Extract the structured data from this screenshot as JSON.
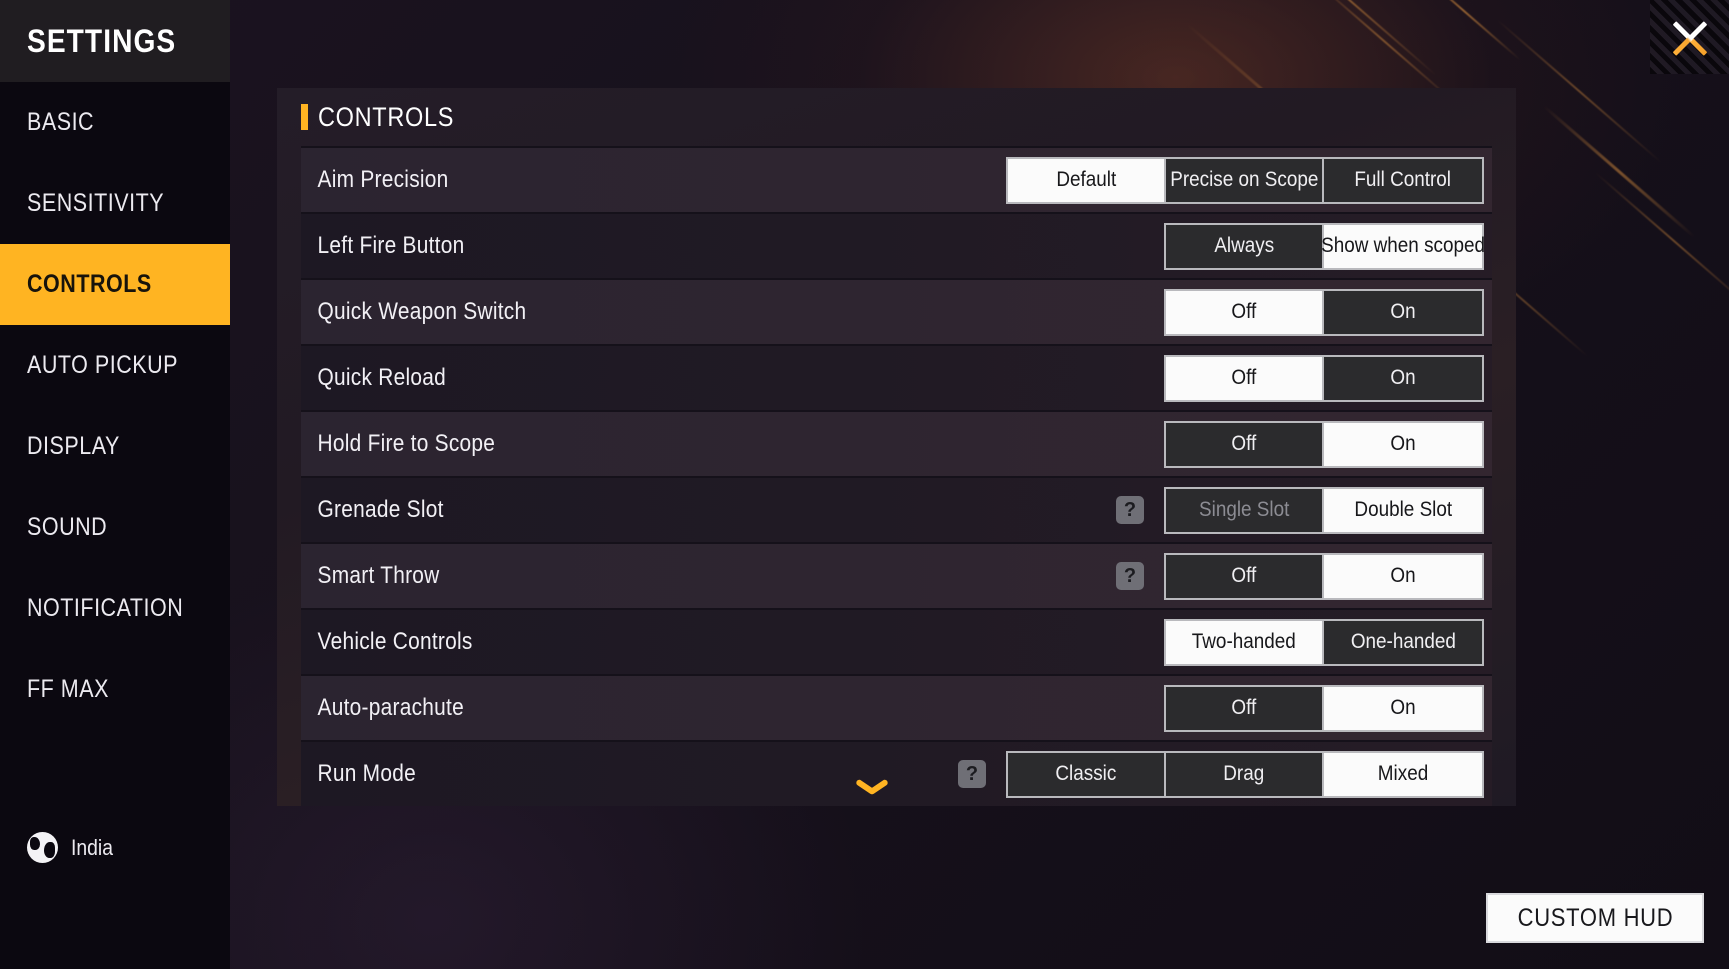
{
  "sidebar": {
    "title": "SETTINGS",
    "items": [
      {
        "label": "BASIC",
        "active": false
      },
      {
        "label": "SENSITIVITY",
        "active": false
      },
      {
        "label": "CONTROLS",
        "active": true
      },
      {
        "label": "AUTO PICKUP",
        "active": false
      },
      {
        "label": "DISPLAY",
        "active": false
      },
      {
        "label": "SOUND",
        "active": false
      },
      {
        "label": "NOTIFICATION",
        "active": false
      },
      {
        "label": "FF MAX",
        "active": false
      }
    ],
    "locale": {
      "icon": "globe-icon",
      "label": "India"
    }
  },
  "panel": {
    "title": "CONTROLS",
    "accent_color": "#FFB422",
    "rows": [
      {
        "label": "Aim Precision",
        "help": false,
        "options": [
          {
            "label": "Default",
            "selected": true,
            "disabled": false
          },
          {
            "label": "Precise on Scope",
            "selected": false,
            "disabled": false
          },
          {
            "label": "Full Control",
            "selected": false,
            "disabled": false
          }
        ]
      },
      {
        "label": "Left Fire Button",
        "help": false,
        "options": [
          {
            "label": "Always",
            "selected": false,
            "disabled": false
          },
          {
            "label": "Show when scoped",
            "selected": true,
            "disabled": false
          }
        ]
      },
      {
        "label": "Quick Weapon Switch",
        "help": false,
        "options": [
          {
            "label": "Off",
            "selected": true,
            "disabled": false
          },
          {
            "label": "On",
            "selected": false,
            "disabled": false
          }
        ]
      },
      {
        "label": "Quick Reload",
        "help": false,
        "options": [
          {
            "label": "Off",
            "selected": true,
            "disabled": false
          },
          {
            "label": "On",
            "selected": false,
            "disabled": false
          }
        ]
      },
      {
        "label": "Hold Fire to Scope",
        "help": false,
        "options": [
          {
            "label": "Off",
            "selected": false,
            "disabled": false
          },
          {
            "label": "On",
            "selected": true,
            "disabled": false
          }
        ]
      },
      {
        "label": "Grenade Slot",
        "help": true,
        "options": [
          {
            "label": "Single Slot",
            "selected": false,
            "disabled": true
          },
          {
            "label": "Double Slot",
            "selected": true,
            "disabled": false
          }
        ]
      },
      {
        "label": "Smart Throw",
        "help": true,
        "options": [
          {
            "label": "Off",
            "selected": false,
            "disabled": false
          },
          {
            "label": "On",
            "selected": true,
            "disabled": false
          }
        ]
      },
      {
        "label": "Vehicle Controls",
        "help": false,
        "options": [
          {
            "label": "Two-handed",
            "selected": true,
            "disabled": false
          },
          {
            "label": "One-handed",
            "selected": false,
            "disabled": false
          }
        ]
      },
      {
        "label": "Auto-parachute",
        "help": false,
        "options": [
          {
            "label": "Off",
            "selected": false,
            "disabled": false
          },
          {
            "label": "On",
            "selected": true,
            "disabled": false
          }
        ]
      },
      {
        "label": "Run Mode",
        "help": true,
        "options": [
          {
            "label": "Classic",
            "selected": false,
            "disabled": false
          },
          {
            "label": "Drag",
            "selected": false,
            "disabled": false
          },
          {
            "label": "Mixed",
            "selected": true,
            "disabled": false
          }
        ]
      }
    ]
  },
  "footer": {
    "custom_hud_label": "CUSTOM HUD"
  },
  "icons": {
    "close": "close-icon",
    "scroll_down": "chevron-down-icon",
    "help": "question-mark-icon"
  },
  "help_icon_glyph": "?"
}
